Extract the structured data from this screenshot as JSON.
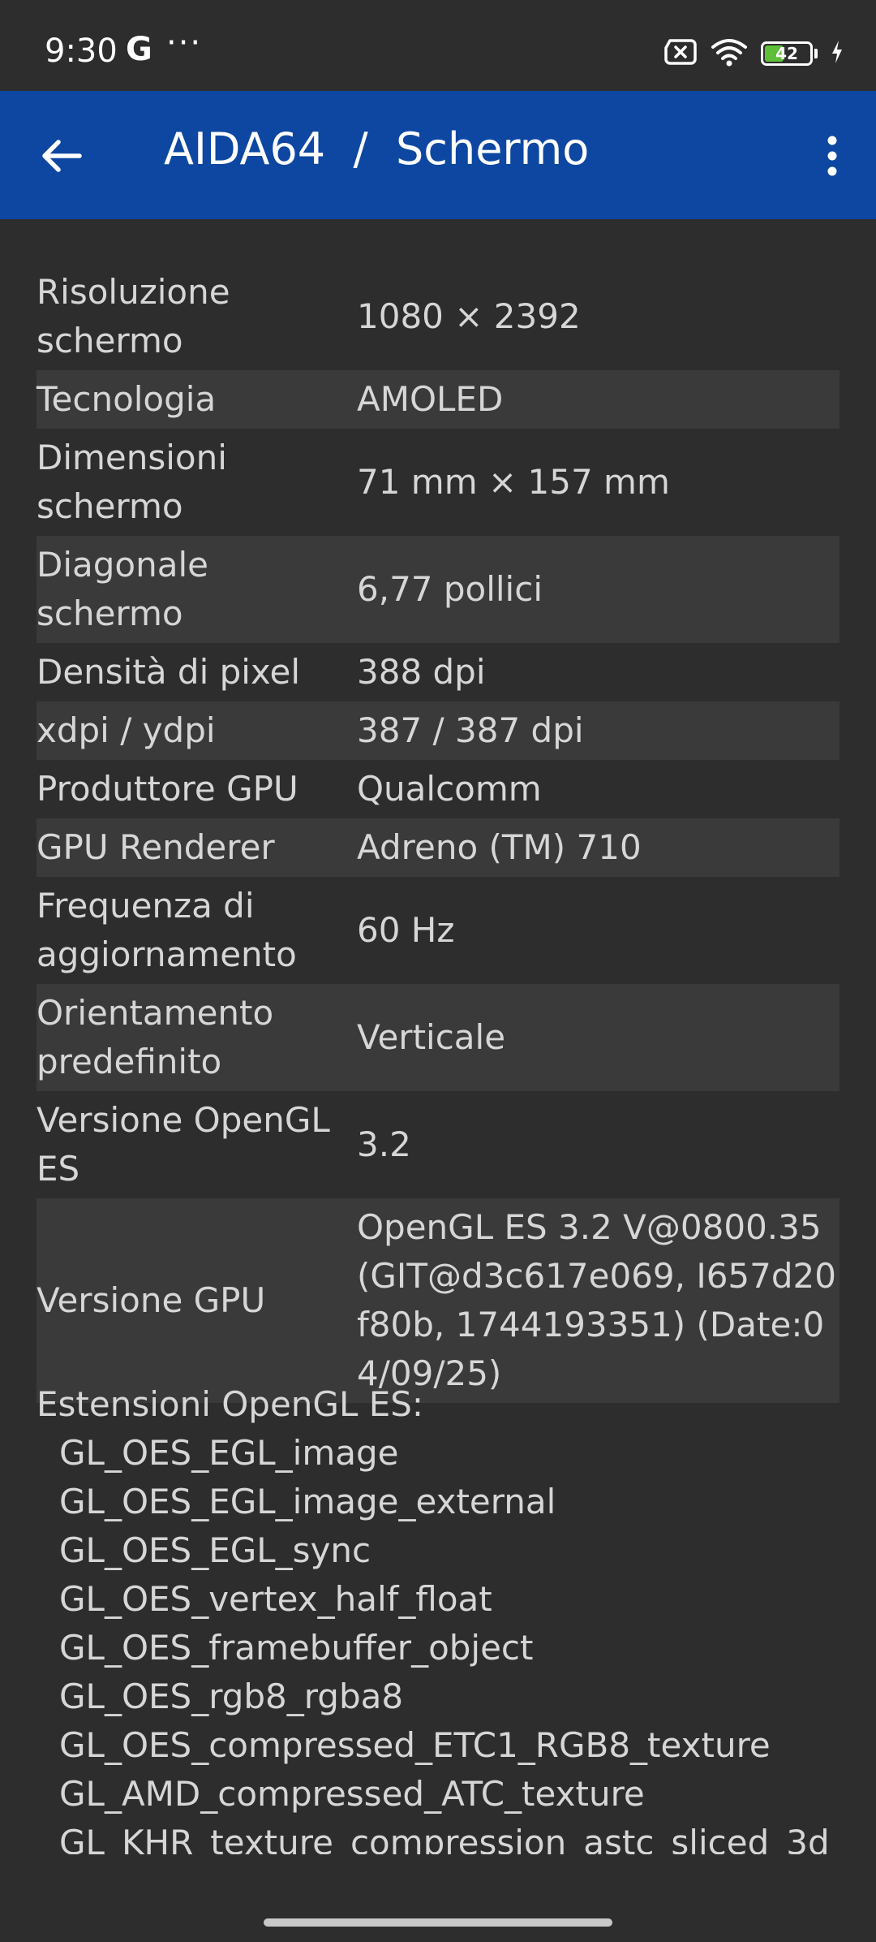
{
  "status_bar": {
    "time": "9:30",
    "g_icon_text": "G",
    "more_icon_text": "···",
    "battery_level": "42",
    "battery_fraction": 0.42,
    "battery_fill_color": "#5fbf3a",
    "icons": [
      "google-icon",
      "more-notifications-icon",
      "no-sim-icon",
      "wifi-icon",
      "battery-icon",
      "charging-icon"
    ]
  },
  "app_bar": {
    "title": "AIDA64  /  Schermo",
    "background_color": "#0d47a1",
    "back_icon": "arrow-left-icon",
    "menu_icon": "more-vert-icon"
  },
  "rows": [
    {
      "label": "Risoluzione schermo",
      "value": "1080 × 2392"
    },
    {
      "label": "Tecnologia",
      "value": "AMOLED"
    },
    {
      "label": "Dimensioni schermo",
      "value": "71 mm × 157 mm"
    },
    {
      "label": "Diagonale schermo",
      "value": "6,77 pollici"
    },
    {
      "label": "Densità di pixel",
      "value": "388 dpi"
    },
    {
      "label": "xdpi / ydpi",
      "value": "387 / 387 dpi"
    },
    {
      "label": "Produttore GPU",
      "value": "Qualcomm"
    },
    {
      "label": "GPU Renderer",
      "value": "Adreno (TM) 710"
    },
    {
      "label": "Frequenza di aggiornamento",
      "value": "60 Hz"
    },
    {
      "label": "Orientamento predefinito",
      "value": "Verticale"
    },
    {
      "label": "Versione OpenGL ES",
      "value": "3.2"
    },
    {
      "label": "Versione GPU",
      "value": "OpenGL ES 3.2 V@0800.35 (GIT@d3c617e069, I657d20f80b, 1744193351) (Date:04/09/25)"
    }
  ],
  "extensions": {
    "title": "Estensioni OpenGL ES:",
    "items": [
      "GL_OES_EGL_image",
      "GL_OES_EGL_image_external",
      "GL_OES_EGL_sync",
      "GL_OES_vertex_half_float",
      "GL_OES_framebuffer_object",
      "GL_OES_rgb8_rgba8",
      "GL_OES_compressed_ETC1_RGB8_texture",
      "GL_AMD_compressed_ATC_texture",
      "GL_KHR_texture_compression_astc_sliced_3d"
    ]
  }
}
